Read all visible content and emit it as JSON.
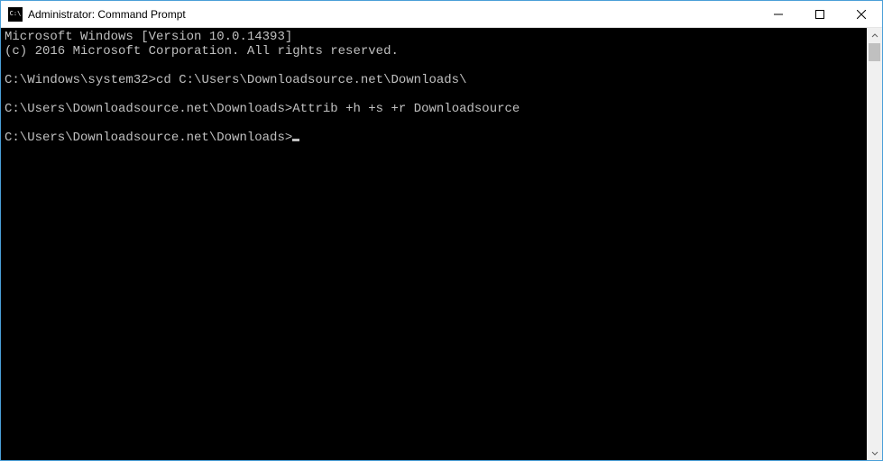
{
  "window": {
    "title": "Administrator: Command Prompt",
    "icon_label": "C:\\"
  },
  "console": {
    "line1": "Microsoft Windows [Version 10.0.14393]",
    "line2": "(c) 2016 Microsoft Corporation. All rights reserved.",
    "blank1": "",
    "prompt1": "C:\\Windows\\system32>",
    "cmd1": "cd C:\\Users\\Downloadsource.net\\Downloads\\",
    "blank2": "",
    "prompt2": "C:\\Users\\Downloadsource.net\\Downloads>",
    "cmd2": "Attrib +h +s +r Downloadsource",
    "blank3": "",
    "prompt3": "C:\\Users\\Downloadsource.net\\Downloads>"
  }
}
